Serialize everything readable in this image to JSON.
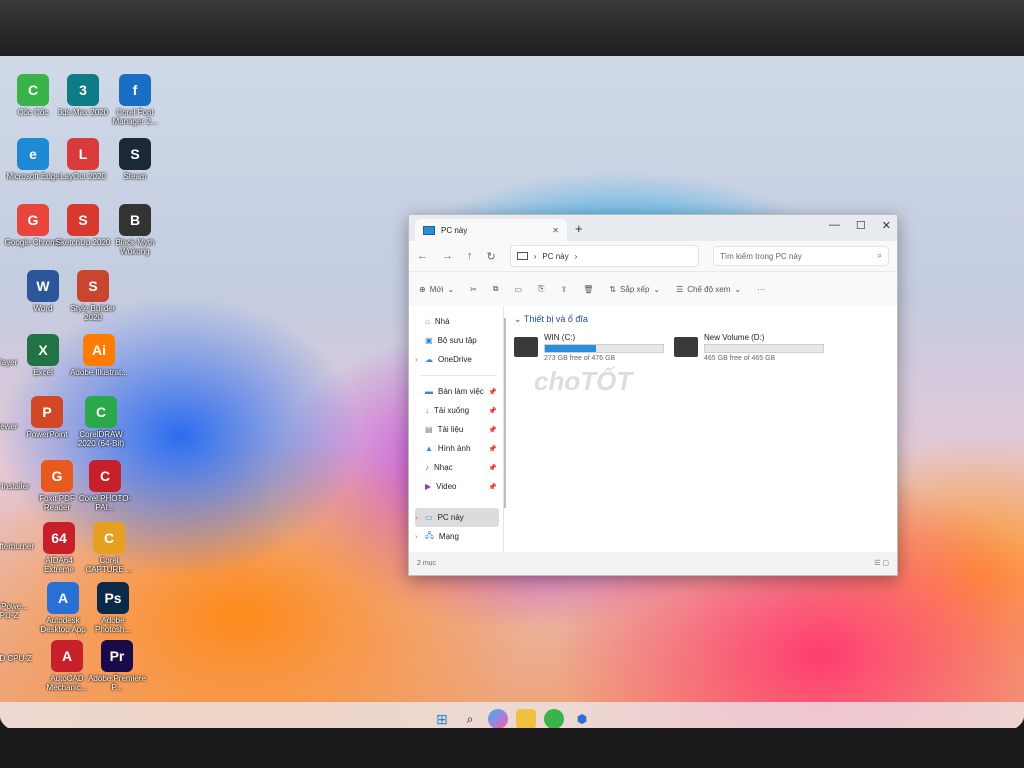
{
  "desktop_icons": [
    {
      "label": "Cốc Cốc",
      "color": "#3ab34a",
      "glyph": "C"
    },
    {
      "label": "3ds Max 2020",
      "color": "#0e7c86",
      "glyph": "3"
    },
    {
      "label": "Corel Font Manager 2...",
      "color": "#1a6fc4",
      "glyph": "f"
    },
    {
      "label": "Microsoft Edge",
      "color": "#1e8ad6",
      "glyph": "e"
    },
    {
      "label": "LayOut 2020",
      "color": "#d93a3a",
      "glyph": "L"
    },
    {
      "label": "Steam",
      "color": "#1b2838",
      "glyph": "S"
    },
    {
      "label": "Google Chrome",
      "color": "#e8453c",
      "glyph": "G"
    },
    {
      "label": "SketchUp 2020",
      "color": "#d9382e",
      "glyph": "S"
    },
    {
      "label": "Black Myth Wukong",
      "color": "#333333",
      "glyph": "B"
    },
    {
      "label": "Word",
      "color": "#2b579a",
      "glyph": "W"
    },
    {
      "label": "Style Builder 2020",
      "color": "#c8452e",
      "glyph": "S"
    },
    {
      "label": "Excel",
      "color": "#217346",
      "glyph": "X"
    },
    {
      "label": "Adobe Illustrat...",
      "color": "#ff7c00",
      "glyph": "Ai"
    },
    {
      "label": "PowerPoint",
      "color": "#d24726",
      "glyph": "P"
    },
    {
      "label": "CorelDRAW 2020 (64-Bit)",
      "color": "#2aa84a",
      "glyph": "C"
    },
    {
      "label": "Foxit PDF Reader",
      "color": "#e65a20",
      "glyph": "G"
    },
    {
      "label": "Corel PHOTO-PAI...",
      "color": "#c8202a",
      "glyph": "C"
    },
    {
      "label": "AIDA64 Extreme",
      "color": "#c8202a",
      "glyph": "64"
    },
    {
      "label": "Corel CAPTURE ...",
      "color": "#e6a020",
      "glyph": "C"
    },
    {
      "label": "Autodesk Desktop App",
      "color": "#2a6fd6",
      "glyph": "A"
    },
    {
      "label": "Adobe Photosh...",
      "color": "#0b2a4a",
      "glyph": "Ps"
    },
    {
      "label": "AutoCAD Mechanic...",
      "color": "#c8202a",
      "glyph": "A"
    },
    {
      "label": "Adobe Premiere P...",
      "color": "#1a0a4a",
      "glyph": "Pr"
    }
  ],
  "edge_icons": [
    {
      "label": "Player"
    },
    {
      "label": "viewer"
    },
    {
      "label": "HiBit Installer"
    },
    {
      "label": "MSI Afterburner"
    },
    {
      "label": "TechPowe... GPU-Z"
    },
    {
      "label": "CPUID CPU-Z"
    }
  ],
  "explorer": {
    "tab_title": "PC này",
    "new_tab": "+",
    "controls": {
      "min": "—",
      "max": "☐",
      "close": "✕"
    },
    "address_path": "PC này",
    "search_placeholder": "Tìm kiếm trong PC này",
    "toolbar": {
      "new": "Mới",
      "sort": "Sắp xếp",
      "view": "Chế độ xem",
      "more": "···"
    },
    "nav": {
      "home": "Nhà",
      "gallery": "Bộ sưu tập",
      "onedrive": "OneDrive",
      "desktop": "Bàn làm việc",
      "downloads": "Tải xuống",
      "documents": "Tài liệu",
      "pictures": "Hình ảnh",
      "music": "Nhạc",
      "videos": "Video",
      "this_pc": "PC này",
      "network": "Mạng"
    },
    "group_header": "Thiết bị và ổ đĩa",
    "drives": [
      {
        "name": "WIN (C:)",
        "size": "273 GB free of 476 GB",
        "used_fraction": 0.43
      },
      {
        "name": "New Volume (D:)",
        "size": "465 GB free of 465 GB",
        "used_fraction": 0.0
      }
    ],
    "status": "2 mục"
  },
  "watermark": "choTỐT"
}
